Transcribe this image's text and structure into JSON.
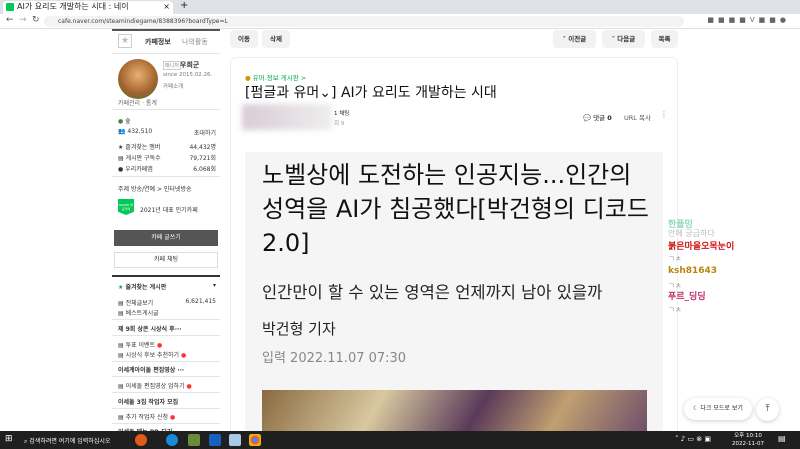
{
  "browser": {
    "tab_title": "AI가 요리도 개발하는 시대 : 네이",
    "url": "cafe.naver.com/steamindiegame/8388396?boardType=L"
  },
  "sidebar": {
    "tab_info": "카페정보",
    "tab_activity": "나의활동",
    "manager_label": "매니저",
    "manager_name": "우희군",
    "since": "since 2015.02.26.",
    "intro": "카페소개",
    "admin": "카페관리",
    "stats": "통계",
    "grade": "숲",
    "members": "432,510",
    "invite": "초대하기",
    "fav_members_label": "즐겨찾는 멤버",
    "fav_members": "44,432명",
    "board_subs_label": "게시판 구독수",
    "board_subs": "79,721회",
    "app_label": "우리카페앱",
    "app_count": "6,068회",
    "topic": "주제  방송/연예 > 인터넷방송",
    "badge": "NAVER 대표카페",
    "badge_text": "2021년 대표 인기카페",
    "write_button": "카페 글쓰기",
    "chat_button": "카페 채팅",
    "fav_boards": "즐겨찾는 게시판",
    "all_posts": "전체글보기",
    "all_posts_count": "6,621,415",
    "boards": [
      {
        "label": "베스트게시글",
        "type": "item"
      },
      {
        "label": "제 9회 상콘 시상식 후···",
        "type": "header"
      },
      {
        "label": "투표 이벤트",
        "type": "item",
        "new": true
      },
      {
        "label": "시상식 후보 추천하기",
        "type": "item",
        "new": true
      },
      {
        "label": "이세계아이돌 편집영상 ···",
        "type": "header"
      },
      {
        "label": "이세돌 편집영상 업하기",
        "type": "item",
        "new": true
      },
      {
        "label": "이세돌 3집 작업자 모집",
        "type": "header"
      },
      {
        "label": "추가 작업자 신청",
        "type": "item",
        "new": true
      },
      {
        "label": "이세돌 메는 PD 되기",
        "type": "header"
      }
    ]
  },
  "toolbar": {
    "move": "이동",
    "delete": "삭제",
    "prev": "이전글",
    "next": "다음글",
    "list": "목록"
  },
  "article": {
    "board": "유머.정보 게시판 >",
    "title": "[펌글과 유머⌄] AI가 요리도 개발하는 시대",
    "author_tag": "1 채팅",
    "views": "회 9",
    "comments_label": "댓글",
    "comments": "0",
    "url_copy": "URL 복사",
    "headline": "노벨상에 도전하는 인공지능...인간의 성역을 AI가 침공했다[박건형의 디코드 2.0]",
    "subtitle": "인간만이 할 수 있는 영역은 언제까지 남아 있을까",
    "reporter": "박건형 기자",
    "date": "입력 2022.11.07 07:30"
  },
  "chat": [
    {
      "user": "한플밍",
      "msg": "안에 궁금하다",
      "color": "#8fd9b6"
    },
    {
      "user": "붉은마을오목눈이",
      "msg": "ㄱㅊ",
      "color": "#d01010"
    },
    {
      "user": "ksh81643",
      "msg": "ㄱㅊ",
      "color": "#b8860b"
    },
    {
      "user": "푸르_딩딩",
      "msg": "ㄱㅊ",
      "color": "#c0306a"
    }
  ],
  "floating": {
    "dark_mode": "다크 모드로 보기"
  },
  "taskbar": {
    "search": "검색하려면 여기에 입력하십시오",
    "time": "오후 10:10",
    "date": "2022-11-07"
  }
}
